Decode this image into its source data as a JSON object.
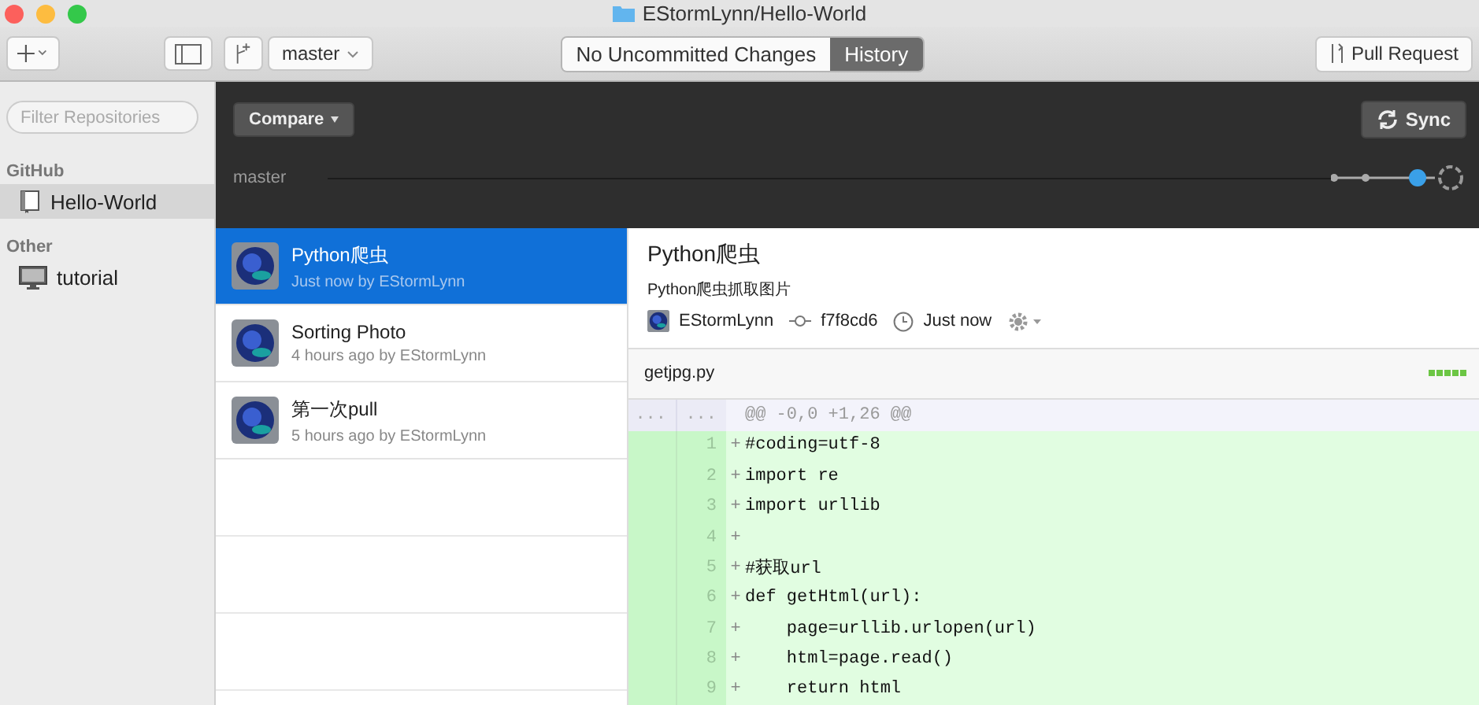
{
  "window": {
    "title": "EStormLynn/Hello-World"
  },
  "toolbar": {
    "branch": "master",
    "tabs": [
      {
        "label": "No Uncommitted Changes",
        "selected": false
      },
      {
        "label": "History",
        "selected": true
      }
    ],
    "pull_request": "Pull Request"
  },
  "sidebar": {
    "filter": {
      "placeholder": "Filter Repositories"
    },
    "groups": [
      {
        "title": "GitHub",
        "items": [
          {
            "label": "Hello-World",
            "kind": "repo",
            "selected": true
          }
        ]
      },
      {
        "title": "Other",
        "items": [
          {
            "label": "tutorial",
            "kind": "computer",
            "selected": false
          }
        ]
      }
    ]
  },
  "branch_bar": {
    "compare": "Compare",
    "sync": "Sync",
    "branch": "master"
  },
  "commits": [
    {
      "title": "Python爬虫",
      "meta": "Just now by EStormLynn",
      "selected": true
    },
    {
      "title": "Sorting Photo",
      "meta": "4 hours ago by EStormLynn",
      "selected": false
    },
    {
      "title": "第一次pull",
      "meta": "5 hours ago by EStormLynn",
      "selected": false
    }
  ],
  "detail": {
    "title": "Python爬虫",
    "description": "Python爬虫抓取图片",
    "author": "EStormLynn",
    "sha": "f7f8cd6",
    "time": "Just now"
  },
  "diff": {
    "file": "getjpg.py",
    "hunk": {
      "old": "...",
      "new": "...",
      "text": "@@ -0,0 +1,26 @@"
    },
    "lines": [
      {
        "new": "1",
        "marker": "+",
        "text": "#coding=utf-8"
      },
      {
        "new": "2",
        "marker": "+",
        "text": "import re"
      },
      {
        "new": "3",
        "marker": "+",
        "text": "import urllib"
      },
      {
        "new": "4",
        "marker": "+"
      },
      {
        "new": "5",
        "marker": "+",
        "text": "#获取url"
      },
      {
        "new": "6",
        "marker": "+",
        "text": "def getHtml(url):"
      },
      {
        "new": "7",
        "marker": "+",
        "text": "    page=urllib.urlopen(url)"
      },
      {
        "new": "8",
        "marker": "+",
        "text": "    html=page.read()"
      },
      {
        "new": "9",
        "marker": "+",
        "text": "    return html"
      }
    ]
  }
}
